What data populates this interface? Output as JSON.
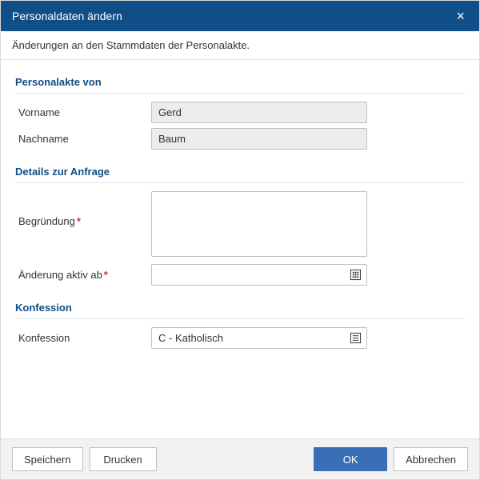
{
  "dialog": {
    "title": "Personaldaten ändern",
    "subtitle": "Änderungen an den Stammdaten der Personalakte."
  },
  "sections": {
    "personalakte": {
      "title": "Personalakte von",
      "vorname_label": "Vorname",
      "vorname_value": "Gerd",
      "nachname_label": "Nachname",
      "nachname_value": "Baum"
    },
    "details": {
      "title": "Details zur Anfrage",
      "begruendung_label": "Begründung",
      "begruendung_value": "",
      "aktiv_ab_label": "Änderung aktiv ab",
      "aktiv_ab_value": ""
    },
    "konfession": {
      "title": "Konfession",
      "konfession_label": "Konfession",
      "konfession_value": "C - Katholisch"
    }
  },
  "buttons": {
    "speichern": "Speichern",
    "drucken": "Drucken",
    "ok": "OK",
    "abbrechen": "Abbrechen"
  },
  "required_marker": "*"
}
